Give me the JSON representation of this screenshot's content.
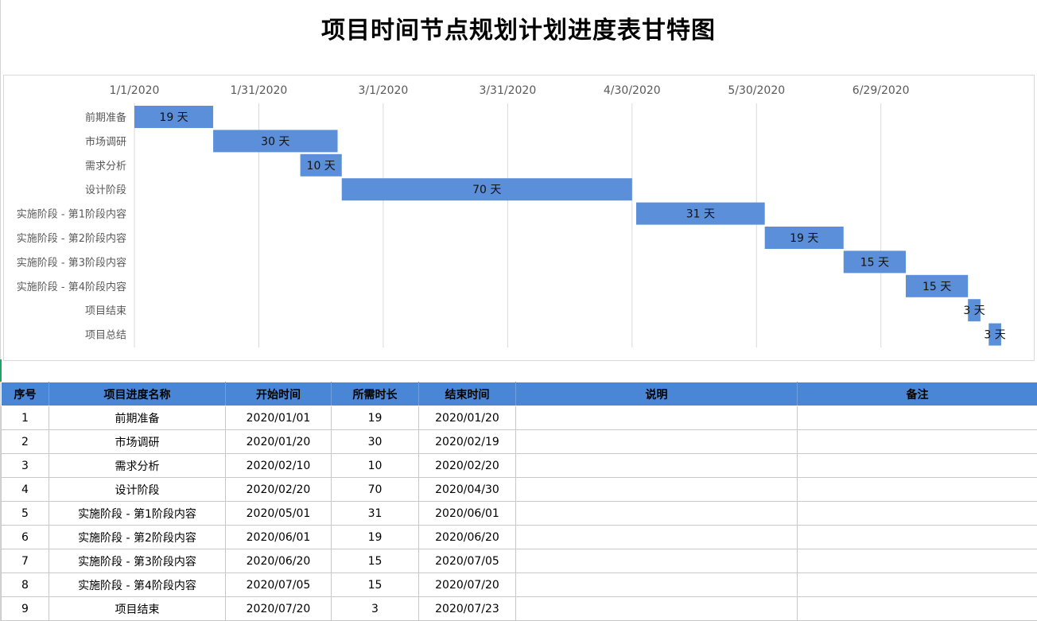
{
  "page": {
    "title": "项目时间节点规划计划进度表甘特图"
  },
  "colors": {
    "bar": "#5b8fd9",
    "header_bg": "#4a86d6",
    "grid": "#d9d9d9"
  },
  "chart_data": {
    "type": "bar",
    "orientation": "horizontal-gantt",
    "x_axis": {
      "type": "date",
      "min": "2020-01-01",
      "max": "2020-07-29",
      "ticks": [
        "1/1/2020",
        "1/31/2020",
        "3/1/2020",
        "3/31/2020",
        "4/30/2020",
        "5/30/2020",
        "6/29/2020"
      ],
      "tick_dates": [
        "2020-01-01",
        "2020-01-31",
        "2020-03-01",
        "2020-03-31",
        "2020-04-30",
        "2020-05-30",
        "2020-06-29"
      ],
      "position": "top"
    },
    "grid": true,
    "categories": [
      "前期准备",
      "市场调研",
      "需求分析",
      "设计阶段",
      "实施阶段 - 第1阶段内容",
      "实施阶段 - 第2阶段内容",
      "实施阶段 - 第3阶段内容",
      "实施阶段 - 第4阶段内容",
      "项目结束",
      "项目总结"
    ],
    "start_dates": [
      "2020-01-01",
      "2020-01-20",
      "2020-02-10",
      "2020-02-20",
      "2020-05-01",
      "2020-06-01",
      "2020-06-20",
      "2020-07-05",
      "2020-07-20",
      "2020-07-25"
    ],
    "durations": [
      19,
      30,
      10,
      70,
      31,
      19,
      15,
      15,
      3,
      3
    ],
    "labels": [
      "19 天",
      "30 天",
      "10 天",
      "70 天",
      "31 天",
      "19 天",
      "15 天",
      "15 天",
      "3 天",
      "3 天"
    ]
  },
  "table": {
    "headers": [
      "序号",
      "项目进度名称",
      "开始时间",
      "所需时长",
      "结束时间",
      "说明",
      "备注"
    ],
    "rows": [
      [
        "1",
        "前期准备",
        "2020/01/01",
        "19",
        "2020/01/20",
        "",
        ""
      ],
      [
        "2",
        "市场调研",
        "2020/01/20",
        "30",
        "2020/02/19",
        "",
        ""
      ],
      [
        "3",
        "需求分析",
        "2020/02/10",
        "10",
        "2020/02/20",
        "",
        ""
      ],
      [
        "4",
        "设计阶段",
        "2020/02/20",
        "70",
        "2020/04/30",
        "",
        ""
      ],
      [
        "5",
        "实施阶段 - 第1阶段内容",
        "2020/05/01",
        "31",
        "2020/06/01",
        "",
        ""
      ],
      [
        "6",
        "实施阶段 - 第2阶段内容",
        "2020/06/01",
        "19",
        "2020/06/20",
        "",
        ""
      ],
      [
        "7",
        "实施阶段 - 第3阶段内容",
        "2020/06/20",
        "15",
        "2020/07/05",
        "",
        ""
      ],
      [
        "8",
        "实施阶段 - 第4阶段内容",
        "2020/07/05",
        "15",
        "2020/07/20",
        "",
        ""
      ],
      [
        "9",
        "项目结束",
        "2020/07/20",
        "3",
        "2020/07/23",
        "",
        ""
      ]
    ]
  }
}
